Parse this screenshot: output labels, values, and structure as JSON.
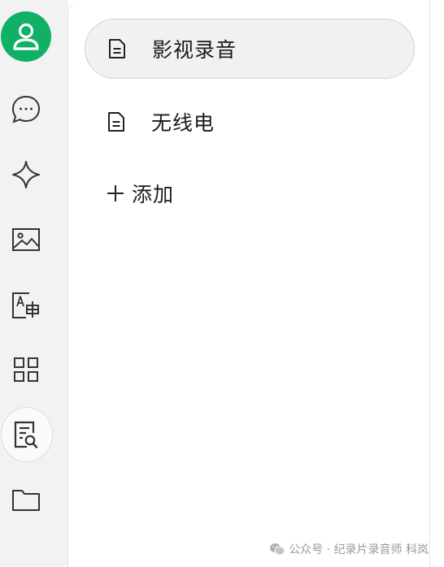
{
  "sidebar": {
    "items": [
      {
        "icon": "user-icon"
      },
      {
        "icon": "chat-bubble-icon"
      },
      {
        "icon": "sparkle-icon"
      },
      {
        "icon": "image-icon"
      },
      {
        "icon": "translate-icon"
      },
      {
        "icon": "grid-apps-icon"
      },
      {
        "icon": "document-search-icon",
        "active": true
      },
      {
        "icon": "folder-icon"
      }
    ],
    "avatar_color": "#10b167"
  },
  "panel": {
    "items": [
      {
        "label": "影视录音",
        "selected": true
      },
      {
        "label": "无线电",
        "selected": false
      }
    ],
    "add_label": "添加"
  },
  "watermark": {
    "text": "公众号 · 纪录片录音师 科岚",
    "icon": "wechat-icon"
  }
}
